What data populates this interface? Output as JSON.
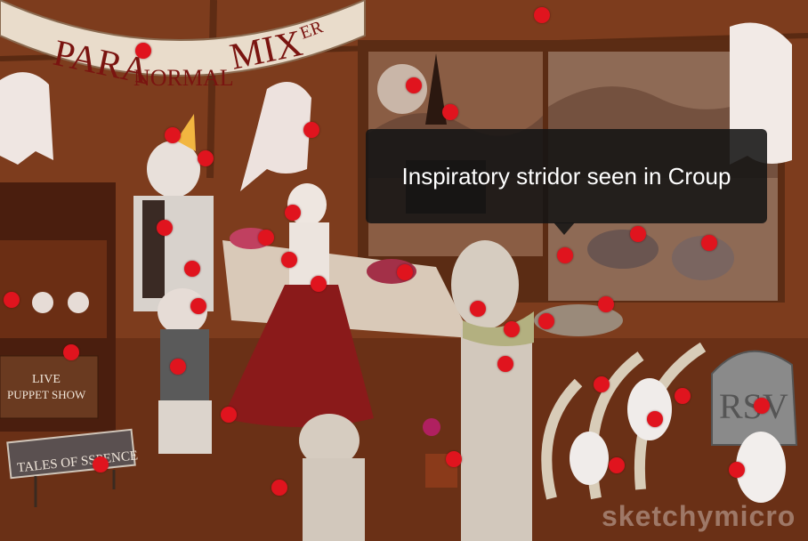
{
  "banner": {
    "left_word": "PARA",
    "middle_word": "NORMAL",
    "right_word": "MIX",
    "right_suffix": "ER"
  },
  "puppet_sign": {
    "line1": "LIVE",
    "line2": "PUPPET SHOW"
  },
  "tales_sign": {
    "text": "TALES OF SSPENCE"
  },
  "tombstone": {
    "text": "RSV"
  },
  "tooltip": {
    "text": "Inspiratory stridor seen in Croup"
  },
  "watermark": {
    "text": "sketchymicro"
  },
  "colors": {
    "hotspot": "#e0141e",
    "wall": "#7a3a1c",
    "tooltip_bg": "#141414"
  },
  "hotspots": [
    {
      "name": "hotspot-banner"
    },
    {
      "name": "hotspot-top-lamp"
    },
    {
      "name": "hotspot-moon"
    },
    {
      "name": "hotspot-steeple"
    },
    {
      "name": "hotspot-ghost-wall"
    },
    {
      "name": "hotspot-party-hat"
    },
    {
      "name": "hotspot-rat-cheek"
    },
    {
      "name": "hotspot-rat-vest"
    },
    {
      "name": "hotspot-rat-belly"
    },
    {
      "name": "hotspot-rat-shirt"
    },
    {
      "name": "hotspot-small-rat-head"
    },
    {
      "name": "hotspot-small-rat-hand"
    },
    {
      "name": "hotspot-small-rat-foot"
    },
    {
      "name": "hotspot-puppet"
    },
    {
      "name": "hotspot-puppet-stage"
    },
    {
      "name": "hotspot-sign"
    },
    {
      "name": "hotspot-bowl"
    },
    {
      "name": "hotspot-lady-head"
    },
    {
      "name": "hotspot-lady-dress"
    },
    {
      "name": "hotspot-lady-neck"
    },
    {
      "name": "hotspot-lady-bowl"
    },
    {
      "name": "hotspot-mummy-face"
    },
    {
      "name": "hotspot-mummy-scarf"
    },
    {
      "name": "hotspot-mummy-chest"
    },
    {
      "name": "hotspot-mummy-hand"
    },
    {
      "name": "hotspot-small-mummy"
    },
    {
      "name": "hotspot-window-ground"
    },
    {
      "name": "hotspot-seal"
    },
    {
      "name": "hotspot-seal-2"
    },
    {
      "name": "hotspot-tentacles"
    },
    {
      "name": "hotspot-tray"
    },
    {
      "name": "hotspot-rib"
    },
    {
      "name": "hotspot-ghost-ribs"
    },
    {
      "name": "hotspot-ghost-small"
    },
    {
      "name": "hotspot-rsv"
    },
    {
      "name": "hotspot-ghost-keys"
    }
  ]
}
